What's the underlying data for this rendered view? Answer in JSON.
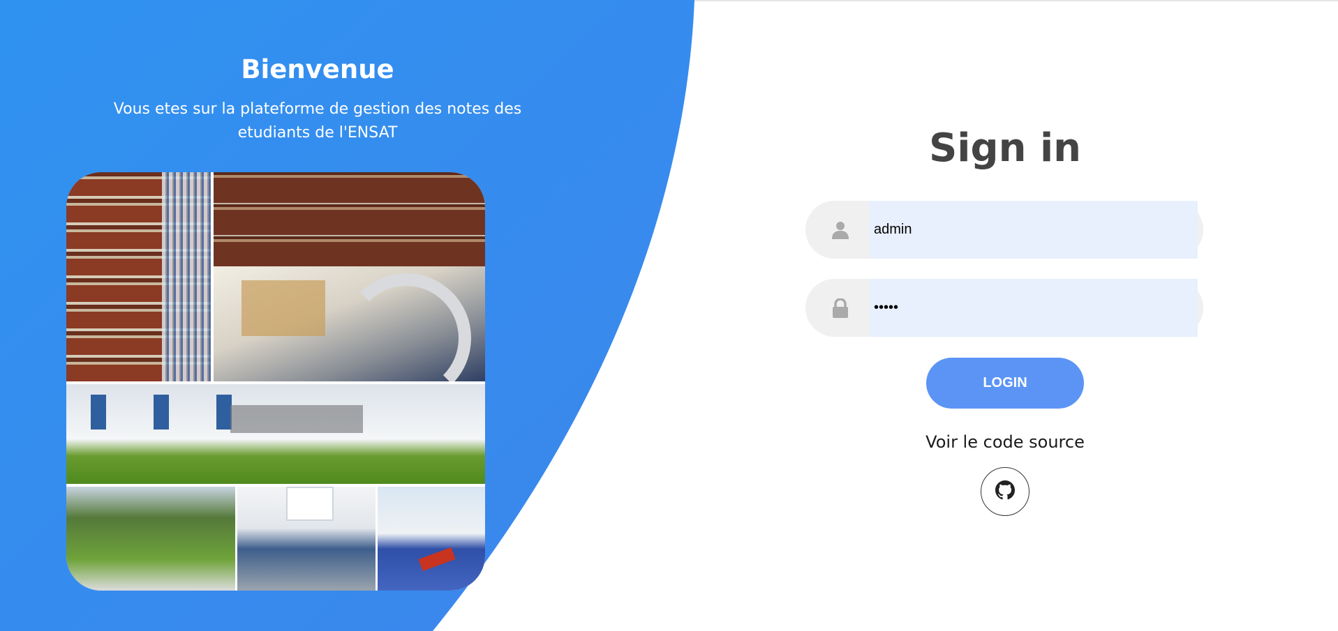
{
  "colors": {
    "accent_blue": "#3a8ff0",
    "button_blue": "#5b94f5",
    "input_fill": "#e8f0fe",
    "field_bg": "#f0f0f0",
    "title_gray": "#444444"
  },
  "welcome": {
    "title": "Bienvenue",
    "text": "Vous etes sur la plateforme de gestion des notes des etudiants de l'ENSAT"
  },
  "collage": {
    "icon": "campus-photo-collage"
  },
  "signin": {
    "title": "Sign in",
    "username": {
      "icon": "user-icon",
      "value": "admin"
    },
    "password": {
      "icon": "lock-icon",
      "value": "•••••"
    },
    "login_label": "LOGIN",
    "source_text": "Voir le code source",
    "github_icon": "github-icon"
  }
}
